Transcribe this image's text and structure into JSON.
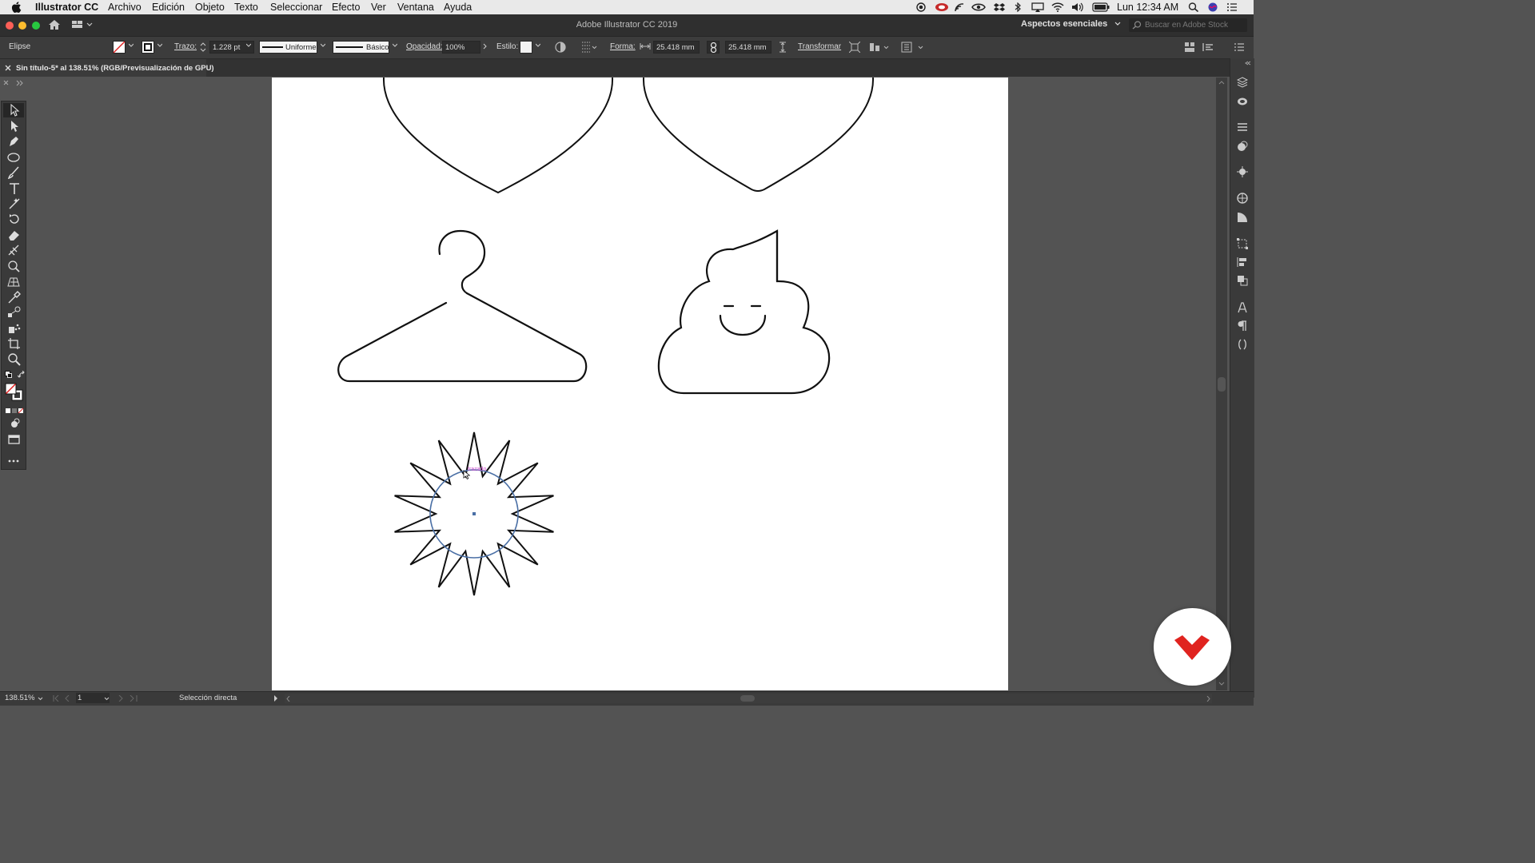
{
  "menubar": {
    "app_name": "Illustrator CC",
    "items": [
      "Archivo",
      "Edición",
      "Objeto",
      "Texto",
      "Seleccionar",
      "Efecto",
      "Ver",
      "Ventana",
      "Ayuda"
    ],
    "clock": "Lun 12:34 AM"
  },
  "window": {
    "title": "Adobe Illustrator CC 2019",
    "workspace": "Aspectos esenciales",
    "search_placeholder": "Buscar en Adobe Stock"
  },
  "control_bar": {
    "selection_label": "Elipse",
    "stroke_label": "Trazo:",
    "stroke_value": "1.228 pt",
    "profile_value": "Uniforme",
    "brush_value": "Básico",
    "opacity_label": "Opacidad:",
    "opacity_value": "100%",
    "style_label": "Estilo:",
    "shape_label": "Forma:",
    "width_value": "25.418 mm",
    "height_value": "25.418 mm",
    "transform_label": "Transformar"
  },
  "document": {
    "tab_title": "Sin título-5* al 138.51% (RGB/Previsualización de GPU)"
  },
  "canvas": {
    "smart_guide_label": "trazado"
  },
  "status_bar": {
    "zoom": "138.51%",
    "artboard_number": "1",
    "tool_name": "Selección directa"
  },
  "colors": {
    "accent_logo": "#e0231f",
    "selection_blue": "#4a6fa5",
    "smart_guide": "#d04fd0"
  }
}
